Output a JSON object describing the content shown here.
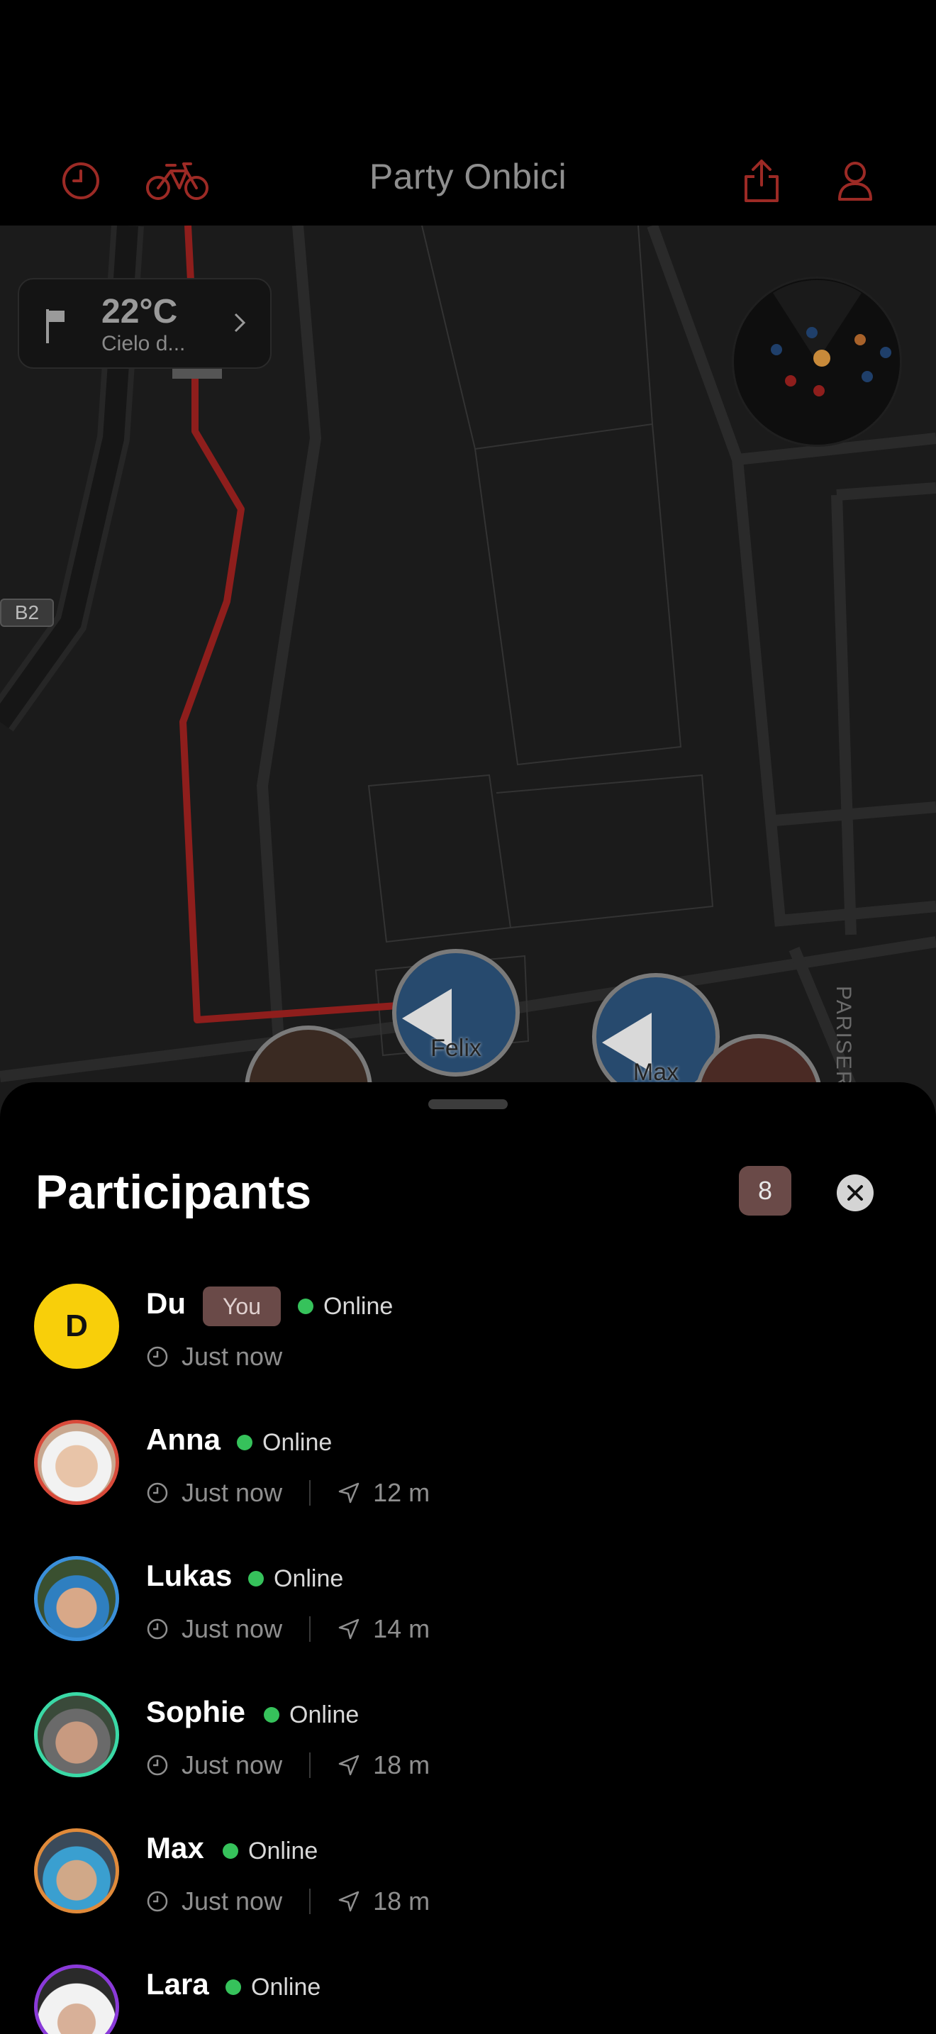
{
  "header": {
    "title": "Party Onbici",
    "icons": {
      "history": "clock-icon",
      "bike": "bicycle-icon",
      "share": "share-icon",
      "profile": "person-icon"
    },
    "accent_color": "#9c2a25"
  },
  "map": {
    "weather": {
      "temperature": "22°C",
      "description": "Cielo d..."
    },
    "road_label": "B2",
    "street_label": "PARISER",
    "route_color": "#8e1e1c",
    "pins": [
      {
        "label": "Felix"
      },
      {
        "label": "Max"
      }
    ]
  },
  "sheet": {
    "title": "Participants",
    "count": "8",
    "participants": [
      {
        "name": "Du",
        "initial": "D",
        "you_badge": "You",
        "status": "Online",
        "time": "Just now",
        "distance": ""
      },
      {
        "name": "Anna",
        "status": "Online",
        "time": "Just now",
        "distance": "12 m",
        "ring_color": "#d94a3a"
      },
      {
        "name": "Lukas",
        "status": "Online",
        "time": "Just now",
        "distance": "14 m",
        "ring_color": "#3a8fd9"
      },
      {
        "name": "Sophie",
        "status": "Online",
        "time": "Just now",
        "distance": "18 m",
        "ring_color": "#3ad9a6"
      },
      {
        "name": "Max",
        "status": "Online",
        "time": "Just now",
        "distance": "18 m",
        "ring_color": "#e08a3a"
      },
      {
        "name": "Lara",
        "status": "Online",
        "time": "",
        "distance": "",
        "ring_color": "#8a3ad9"
      }
    ]
  }
}
